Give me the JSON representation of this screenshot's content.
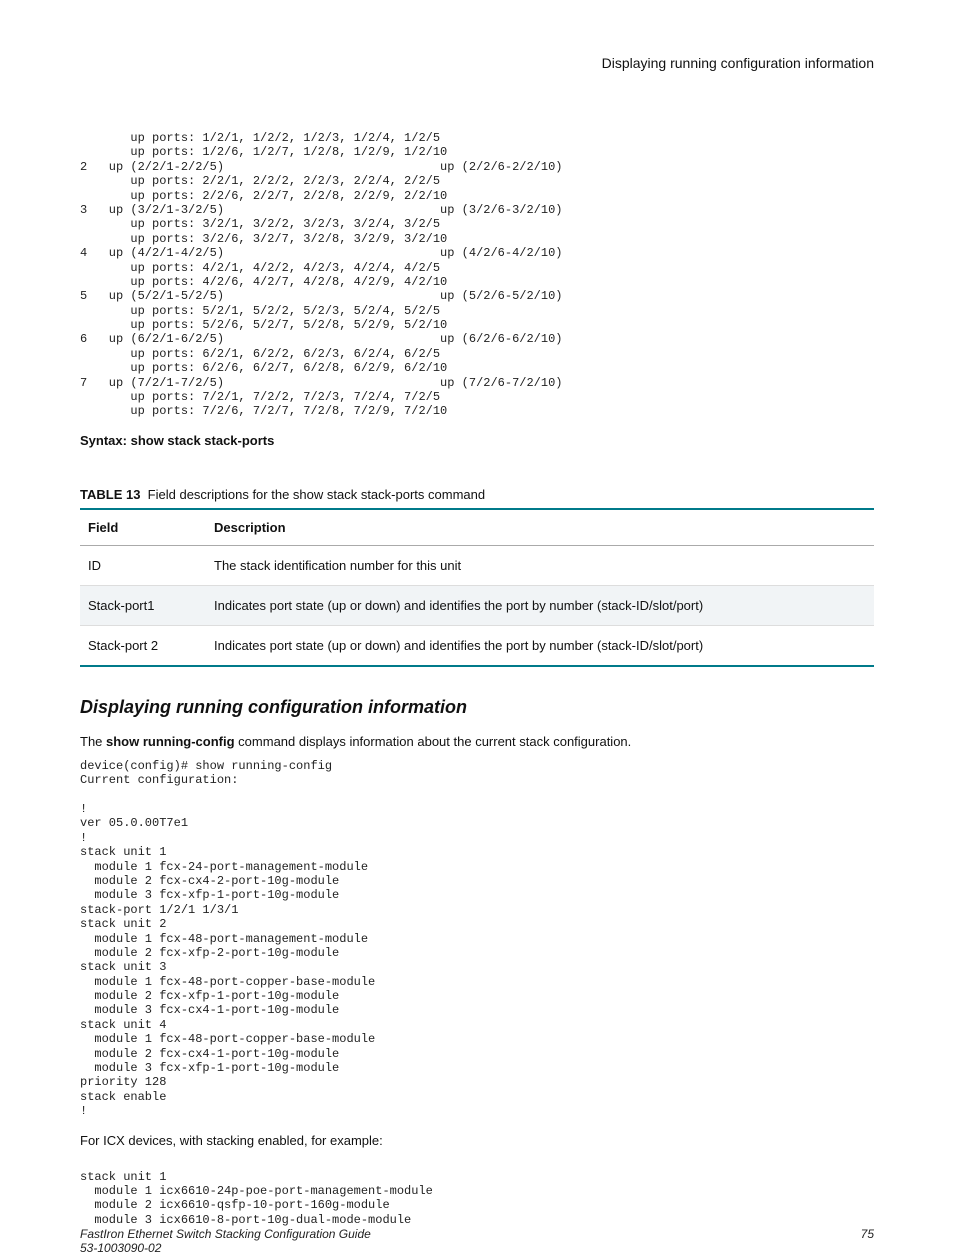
{
  "header": {
    "right": "Displaying running configuration information"
  },
  "block1": "       up ports: 1/2/1, 1/2/2, 1/2/3, 1/2/4, 1/2/5\n       up ports: 1/2/6, 1/2/7, 1/2/8, 1/2/9, 1/2/10\n2   up (2/2/1-2/2/5)                              up (2/2/6-2/2/10)\n       up ports: 2/2/1, 2/2/2, 2/2/3, 2/2/4, 2/2/5\n       up ports: 2/2/6, 2/2/7, 2/2/8, 2/2/9, 2/2/10\n3   up (3/2/1-3/2/5)                              up (3/2/6-3/2/10)\n       up ports: 3/2/1, 3/2/2, 3/2/3, 3/2/4, 3/2/5\n       up ports: 3/2/6, 3/2/7, 3/2/8, 3/2/9, 3/2/10\n4   up (4/2/1-4/2/5)                              up (4/2/6-4/2/10)\n       up ports: 4/2/1, 4/2/2, 4/2/3, 4/2/4, 4/2/5\n       up ports: 4/2/6, 4/2/7, 4/2/8, 4/2/9, 4/2/10\n5   up (5/2/1-5/2/5)                              up (5/2/6-5/2/10)\n       up ports: 5/2/1, 5/2/2, 5/2/3, 5/2/4, 5/2/5\n       up ports: 5/2/6, 5/2/7, 5/2/8, 5/2/9, 5/2/10\n6   up (6/2/1-6/2/5)                              up (6/2/6-6/2/10)\n       up ports: 6/2/1, 6/2/2, 6/2/3, 6/2/4, 6/2/5\n       up ports: 6/2/6, 6/2/7, 6/2/8, 6/2/9, 6/2/10\n7   up (7/2/1-7/2/5)                              up (7/2/6-7/2/10)\n       up ports: 7/2/1, 7/2/2, 7/2/3, 7/2/4, 7/2/5\n       up ports: 7/2/6, 7/2/7, 7/2/8, 7/2/9, 7/2/10",
  "syntax": {
    "label": "Syntax:",
    "cmd": "show stack stack-ports"
  },
  "table": {
    "number": "TABLE 13",
    "caption": "Field descriptions for the show stack stack-ports command",
    "head": {
      "field": "Field",
      "desc": "Description"
    },
    "rows": [
      {
        "field": "ID",
        "desc": "The stack identification number for this unit"
      },
      {
        "field": "Stack-port1",
        "desc": "Indicates port state (up or down) and identifies the port by number (stack-ID/slot/port)"
      },
      {
        "field": "Stack-port 2",
        "desc": "Indicates port state (up or down) and identifies the port by number (stack-ID/slot/port)"
      }
    ]
  },
  "sec": {
    "title": "Displaying running configuration information",
    "intro_pre": "The ",
    "intro_bold": "show running-config",
    "intro_post": " command displays information about the current stack configuration."
  },
  "block2": "device(config)# show running-config\nCurrent configuration:\n\n!\nver 05.0.00T7e1\n!\nstack unit 1\n  module 1 fcx-24-port-management-module\n  module 2 fcx-cx4-2-port-10g-module\n  module 3 fcx-xfp-1-port-10g-module\nstack-port 1/2/1 1/3/1\nstack unit 2\n  module 1 fcx-48-port-management-module\n  module 2 fcx-xfp-2-port-10g-module\nstack unit 3\n  module 1 fcx-48-port-copper-base-module\n  module 2 fcx-xfp-1-port-10g-module\n  module 3 fcx-cx4-1-port-10g-module\nstack unit 4\n  module 1 fcx-48-port-copper-base-module\n  module 2 fcx-cx4-1-port-10g-module\n  module 3 fcx-xfp-1-port-10g-module\npriority 128\nstack enable\n!",
  "icx_intro": "For ICX devices, with stacking enabled, for example:",
  "block3": "stack unit 1\n  module 1 icx6610-24p-poe-port-management-module\n  module 2 icx6610-qsfp-10-port-160g-module\n  module 3 icx6610-8-port-10g-dual-mode-module",
  "footer": {
    "left1": "FastIron Ethernet Switch Stacking Configuration Guide",
    "left2": "53-1003090-02",
    "page": "75"
  }
}
